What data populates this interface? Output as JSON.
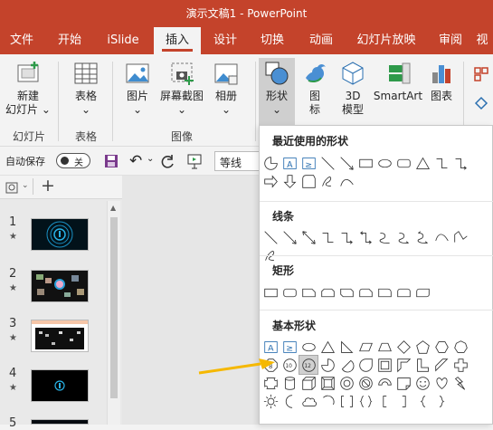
{
  "window": {
    "title": "演示文稿1  -  PowerPoint"
  },
  "tabs": [
    "文件",
    "开始",
    "iSlide",
    "插入",
    "设计",
    "切换",
    "动画",
    "幻灯片放映",
    "审阅",
    "视"
  ],
  "active_tab": "插入",
  "ribbon": {
    "new_slide": {
      "label": "新建",
      "label2": "幻灯片"
    },
    "table": {
      "label": "表格"
    },
    "picture": {
      "label": "图片"
    },
    "screenshot": {
      "label": "屏幕截图"
    },
    "album": {
      "label": "相册"
    },
    "shapes": {
      "label": "形状"
    },
    "icons": {
      "label": "图",
      "label2": "标"
    },
    "model3d": {
      "label": "3D",
      "label2": "模型"
    },
    "smartart": {
      "label": "SmartArt"
    },
    "chart": {
      "label": "图表"
    },
    "groups": {
      "slides": "幻灯片",
      "tables": "表格",
      "images": "图像"
    }
  },
  "qat": {
    "autosave_label": "自动保存",
    "autosave_state": "关",
    "font_box": "等线"
  },
  "slides": [
    {
      "num": "1",
      "mark": "★"
    },
    {
      "num": "2",
      "mark": "★"
    },
    {
      "num": "3",
      "mark": "★"
    },
    {
      "num": "4",
      "mark": "★"
    },
    {
      "num": "5",
      "mark": "★"
    }
  ],
  "shapes_menu": {
    "recent": {
      "title": "最近使用的形状"
    },
    "lines": {
      "title": "线条"
    },
    "rect": {
      "title": "矩形"
    },
    "basic": {
      "title": "基本形状",
      "num10": "10",
      "num12": "12"
    }
  },
  "colors": {
    "accent": "#c4432b",
    "arrow": "#f5b800"
  }
}
